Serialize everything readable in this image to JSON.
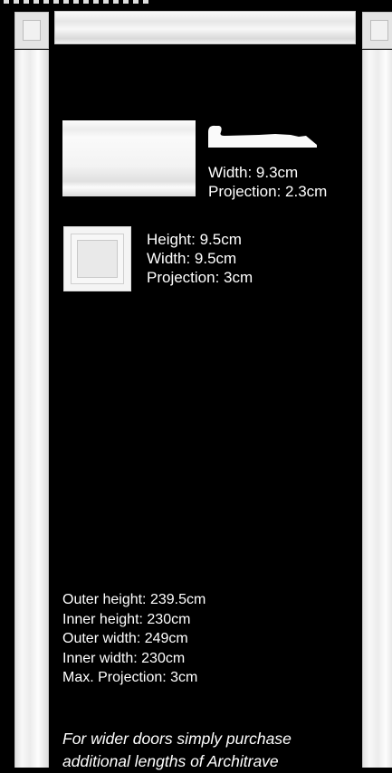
{
  "moulding": {
    "width": "Width: 9.3cm",
    "projection": "Projection: 2.3cm"
  },
  "corner_block": {
    "height": "Height: 9.5cm",
    "width": "Width: 9.5cm",
    "projection": "Projection: 3cm"
  },
  "dimensions": [
    "Outer height: 239.5cm",
    "Inner height: 230cm",
    "Outer width: 249cm",
    "Inner width: 230cm",
    "Max. Projection: 3cm"
  ],
  "note": "For wider doors simply purchase additional lengths of Architrave"
}
